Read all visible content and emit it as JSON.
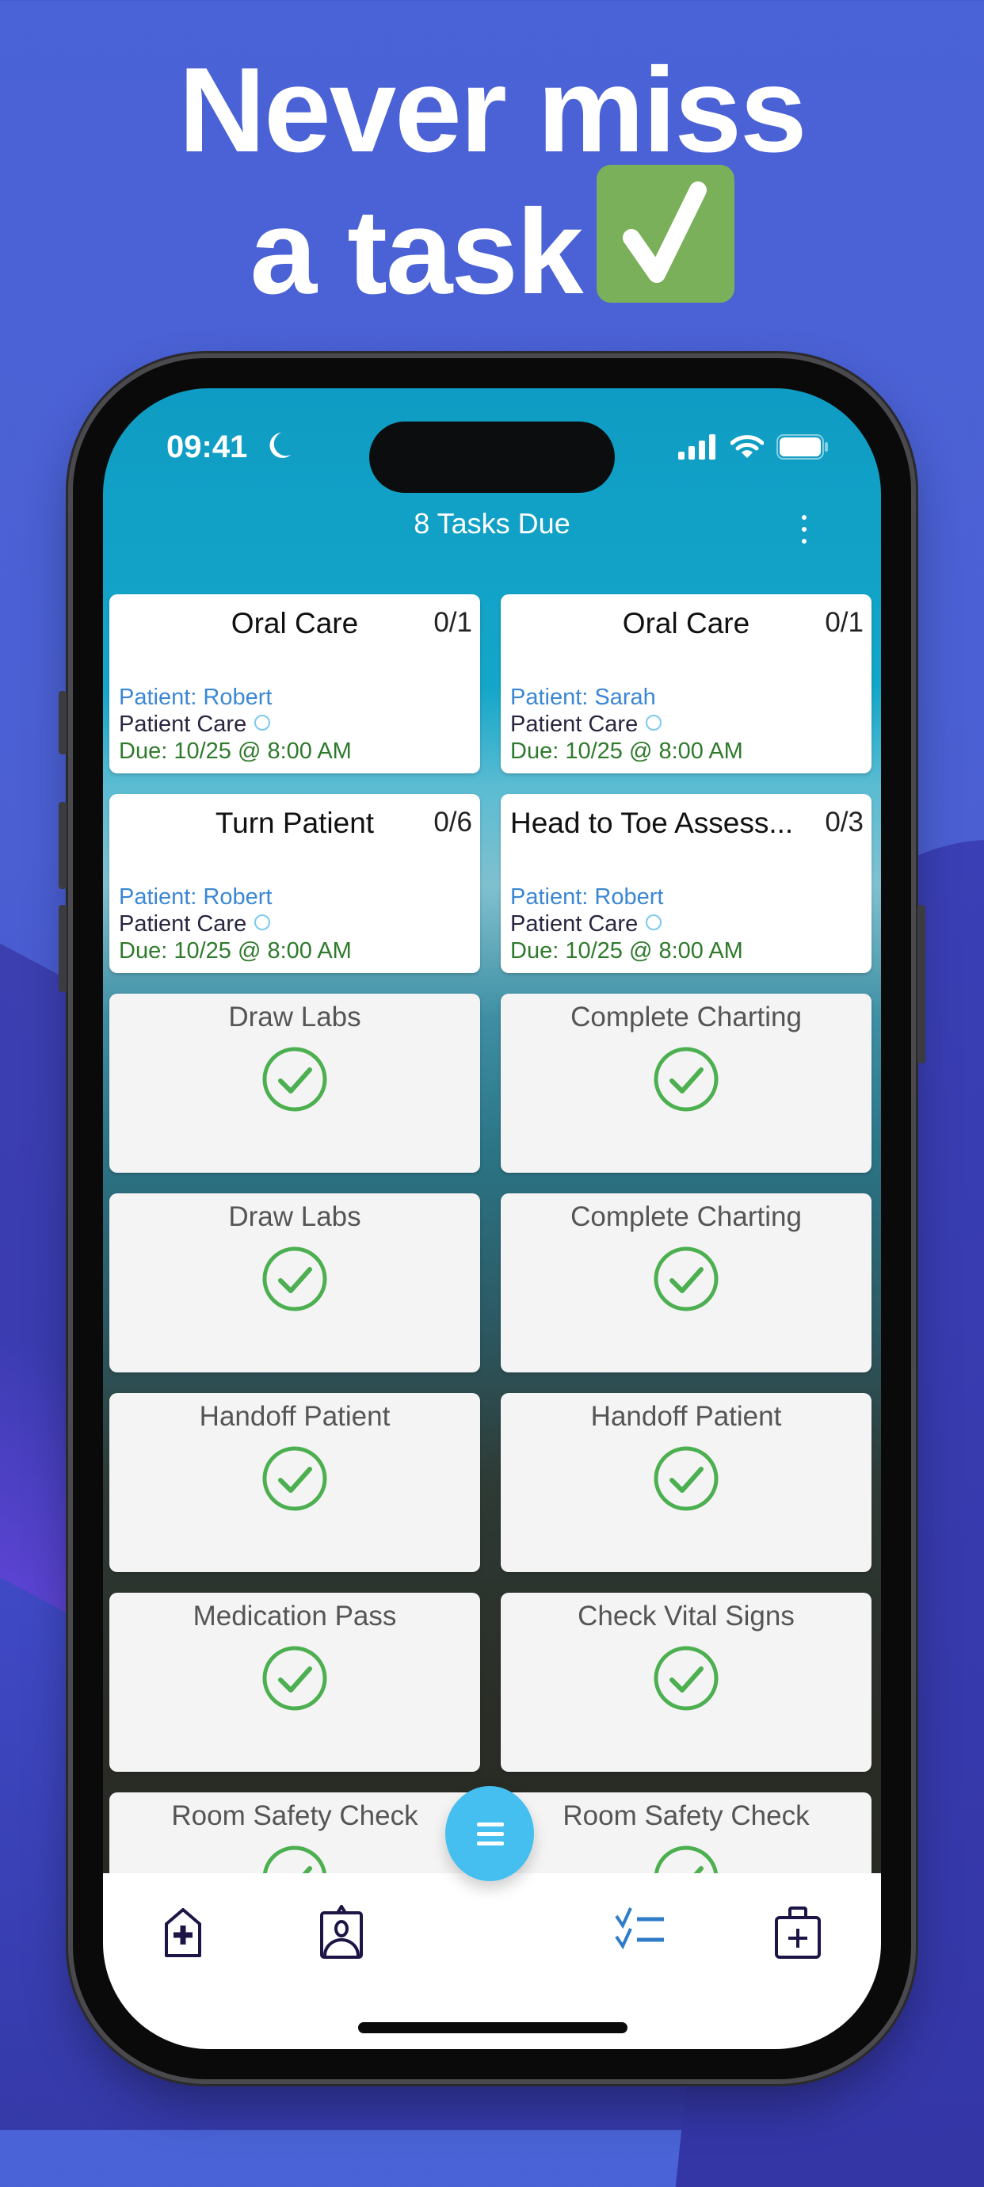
{
  "headline": {
    "line1": "Never miss",
    "line2": "a task",
    "badge_icon": "check-mark-button-icon"
  },
  "status_bar": {
    "time": "09:41",
    "focus_icon": "moon-icon",
    "signal_icon": "cellular-signal-icon",
    "wifi_icon": "wifi-icon",
    "battery_icon": "battery-icon"
  },
  "nav": {
    "title": "8 Tasks Due",
    "menu_icon": "more-vertical-icon"
  },
  "colors": {
    "accent": "#45bff0",
    "patient": "#3b87d4",
    "due": "#2f7a2c",
    "done_check": "#4caf50",
    "headline_badge": "#7ab05a"
  },
  "pending_tasks": [
    {
      "title": "Oral Care",
      "count": "0/1",
      "patient": "Patient: Robert",
      "category": "Patient Care",
      "due": "Due: 10/25 @ 8:00 AM"
    },
    {
      "title": "Oral Care",
      "count": "0/1",
      "patient": "Patient: Sarah",
      "category": "Patient Care",
      "due": "Due: 10/25 @ 8:00 AM"
    },
    {
      "title": "Turn Patient",
      "count": "0/6",
      "patient": "Patient: Robert",
      "category": "Patient Care",
      "due": "Due: 10/25 @ 8:00 AM"
    },
    {
      "title": "Head to Toe Assess...",
      "count": "0/3",
      "patient": "Patient: Robert",
      "category": "Patient Care",
      "due": "Due: 10/25 @ 8:00 AM"
    }
  ],
  "completed_tasks": [
    {
      "title": "Draw Labs"
    },
    {
      "title": "Complete Charting"
    },
    {
      "title": "Draw Labs"
    },
    {
      "title": "Complete Charting"
    },
    {
      "title": "Handoff Patient"
    },
    {
      "title": "Handoff Patient"
    },
    {
      "title": "Medication Pass"
    },
    {
      "title": "Check Vital Signs"
    },
    {
      "title": "Room Safety Check"
    },
    {
      "title": "Room Safety Check"
    }
  ],
  "tab_bar": {
    "items": [
      {
        "name": "hospital",
        "icon": "hospital-icon",
        "active": false
      },
      {
        "name": "badge",
        "icon": "id-badge-icon",
        "active": false
      },
      {
        "name": "tasks",
        "icon": "checklist-icon",
        "active": true
      },
      {
        "name": "medkit",
        "icon": "medical-kit-icon",
        "active": false
      }
    ],
    "fab_icon": "menu-icon"
  }
}
